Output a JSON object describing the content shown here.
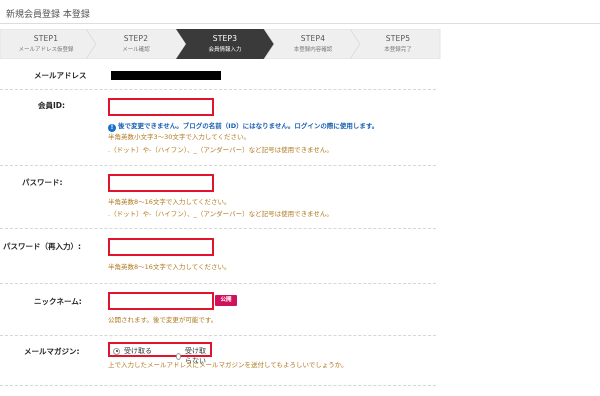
{
  "page": {
    "title": "新規会員登録 本登録"
  },
  "steps": [
    {
      "label": "STEP1",
      "sub": "メールアドレス仮登録",
      "active": false
    },
    {
      "label": "STEP2",
      "sub": "メール確認",
      "active": false
    },
    {
      "label": "STEP3",
      "sub": "会員情報入力",
      "active": true
    },
    {
      "label": "STEP4",
      "sub": "本登録内容確認",
      "active": false
    },
    {
      "label": "STEP5",
      "sub": "本登録完了",
      "active": false
    }
  ],
  "form": {
    "email": {
      "label": "メールアドレス"
    },
    "member_id": {
      "label": "会員ID:",
      "value": "",
      "info": "後で変更できません。ブログの名前（ID）にはなりません。ログインの際に使用します。",
      "help1": "半角英数小文字3〜30文字で入力してください。",
      "help2": ".（ドット）や-（ハイフン）、_（アンダーバー）など記号は使用できません。"
    },
    "password": {
      "label": "パスワード:",
      "value": "",
      "help1": "半角英数8〜16文字で入力してください。",
      "help2": ".（ドット）や-（ハイフン）、_（アンダーバー）など記号は使用できません。"
    },
    "password_confirm": {
      "label": "パスワード（再入力）:",
      "value": "",
      "help1": "半角英数8〜16文字で入力してください。"
    },
    "nickname": {
      "label": "ニックネーム:",
      "value": "",
      "badge": "公開",
      "help1": "公開されます。後で変更が可能です。"
    },
    "magazine": {
      "label": "メールマガジン:",
      "options": [
        "受け取る",
        "受け取らない"
      ],
      "selected": "受け取る",
      "help1": "上で入力したメールアドレスにメールマガジンを送付してもよろしいでしょうか。"
    }
  },
  "colors": {
    "accent": "#e0142c",
    "step_active": "#3a3a3a",
    "step_inactive": "#efefef",
    "help": "#b0781e",
    "info": "#1a5fb4",
    "badge": "#d0125c"
  }
}
